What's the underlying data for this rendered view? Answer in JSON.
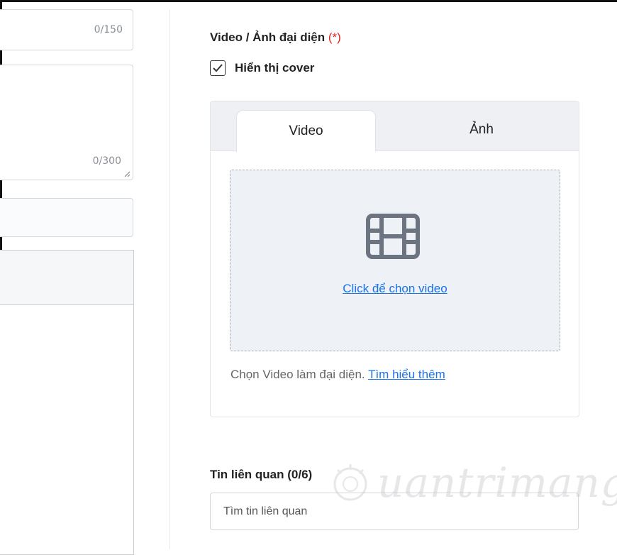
{
  "left_column": {
    "title_counter": "0/150",
    "description_counter": "0/300"
  },
  "media_section": {
    "title": "Video / Ảnh đại diện",
    "required_mark": "(*)",
    "show_cover_label": "Hiển thị cover",
    "show_cover_checked": true,
    "tabs": [
      {
        "label": "Video",
        "active": true
      },
      {
        "label": "Ảnh",
        "active": false
      }
    ],
    "upload_icon": "film-icon",
    "upload_link": "Click để chọn video",
    "hint_text": "Chọn Video làm đại diện.",
    "hint_link": "Tìm hiểu thêm"
  },
  "related_section": {
    "title": "Tin liên quan (0/6)",
    "search_placeholder": "Tìm tin liên quan"
  },
  "watermark": {
    "text": "uantrimang",
    "icon": "sun-icon"
  },
  "colors": {
    "link": "#1a73e8",
    "required": "#e02424",
    "tab_bar_bg": "#eef0f4",
    "drop_zone_bg": "#eef1f5",
    "icon_gray": "#6b7480"
  }
}
